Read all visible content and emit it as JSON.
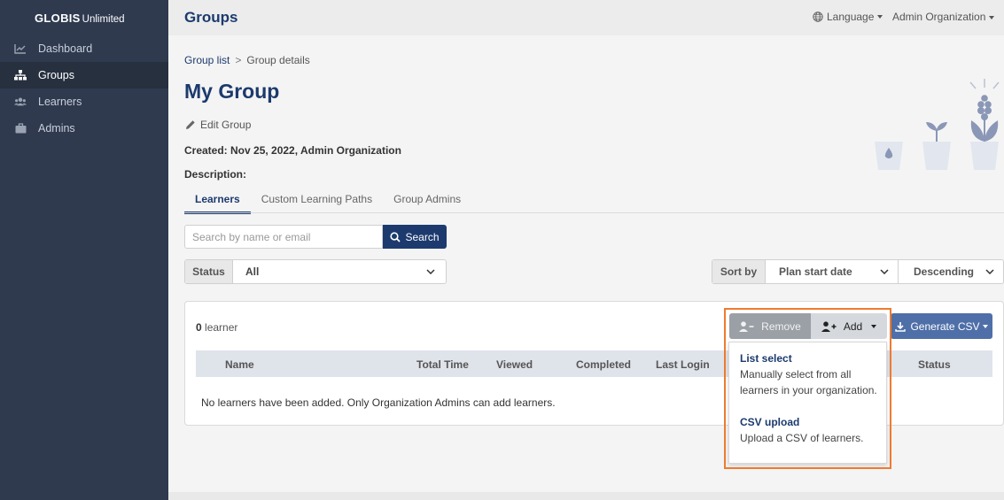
{
  "sidebar": {
    "brand_main": "GLOBIS",
    "brand_sub": "Unlimited",
    "items": [
      {
        "label": "Dashboard",
        "icon": "chart-line-icon",
        "active": false
      },
      {
        "label": "Groups",
        "icon": "sitemap-icon",
        "active": true
      },
      {
        "label": "Learners",
        "icon": "users-icon",
        "active": false
      },
      {
        "label": "Admins",
        "icon": "briefcase-icon",
        "active": false
      }
    ]
  },
  "header": {
    "title": "Groups",
    "language_label": "Language",
    "org_label": "Admin Organization"
  },
  "breadcrumb": {
    "parent": "Group list",
    "separator": ">",
    "current": "Group details"
  },
  "group": {
    "name": "My Group",
    "edit_label": "Edit Group",
    "created_text": "Created: Nov 25, 2022, Admin Organization",
    "description_label": "Description:"
  },
  "tabs": [
    {
      "label": "Learners",
      "active": true
    },
    {
      "label": "Custom Learning Paths",
      "active": false
    },
    {
      "label": "Group Admins",
      "active": false
    }
  ],
  "search": {
    "placeholder": "Search by name or email",
    "value": "",
    "button_label": "Search"
  },
  "filters": {
    "status_label": "Status",
    "status_value": "All",
    "sort_label": "Sort by",
    "sort_field": "Plan start date",
    "sort_order": "Descending"
  },
  "table": {
    "count_number": "0",
    "count_unit": "learner",
    "columns": [
      "Name",
      "Total Time",
      "Viewed",
      "Completed",
      "Last Login",
      "Status"
    ],
    "empty_message": "No learners have been added. Only Organization Admins can add learners."
  },
  "actions": {
    "remove_label": "Remove",
    "add_label": "Add",
    "csv_label": "Generate CSV"
  },
  "add_menu": [
    {
      "title": "List select",
      "description": "Manually select from all learners in your organization."
    },
    {
      "title": "CSV upload",
      "description": "Upload a CSV of learners."
    }
  ],
  "colors": {
    "sidebar_bg": "#2f3a4f",
    "brand_navy": "#1c3a6e",
    "csv_button": "#4f6fa8",
    "highlight": "#ee7b30",
    "illustration": "#d5dbe6"
  }
}
